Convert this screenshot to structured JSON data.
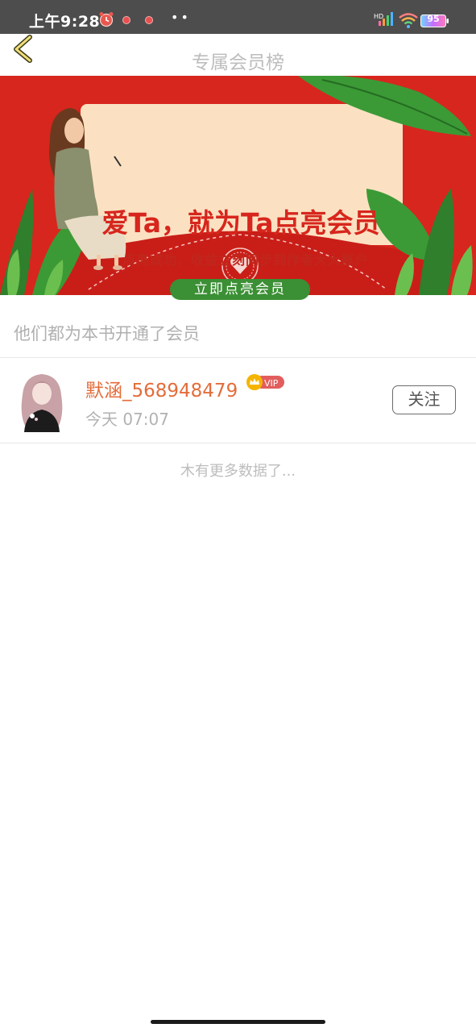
{
  "status_bar": {
    "time": "上午9:28",
    "more": "••",
    "battery": "95",
    "icons": [
      "alarm-icon",
      "notification-dot-icon",
      "notification-dot-icon",
      "hd-signal-icon",
      "wifi-icon",
      "battery-icon"
    ]
  },
  "nav": {
    "title": "专属会员榜",
    "back_icon": "chevron-left-icon"
  },
  "banner": {
    "headline": "爱Ta，就为Ta点亮会员",
    "subtitle": "点亮成功，收益立刻同步到作者大大账户",
    "cta_label": "立即点亮会员",
    "colors": {
      "background": "#d7261d",
      "card": "#fbe1c2",
      "cta": "#3b8f34"
    }
  },
  "section": {
    "title": "他们都为本书开通了会员"
  },
  "members": [
    {
      "name": "默涵_568948479",
      "badge": "VIP",
      "time": "今天 07:07",
      "follow_label": "关注"
    }
  ],
  "list_end_text": "木有更多数据了...",
  "colors": {
    "name": "#e46c3a",
    "vip": "#e25d5d",
    "crown": "#f5b400"
  }
}
